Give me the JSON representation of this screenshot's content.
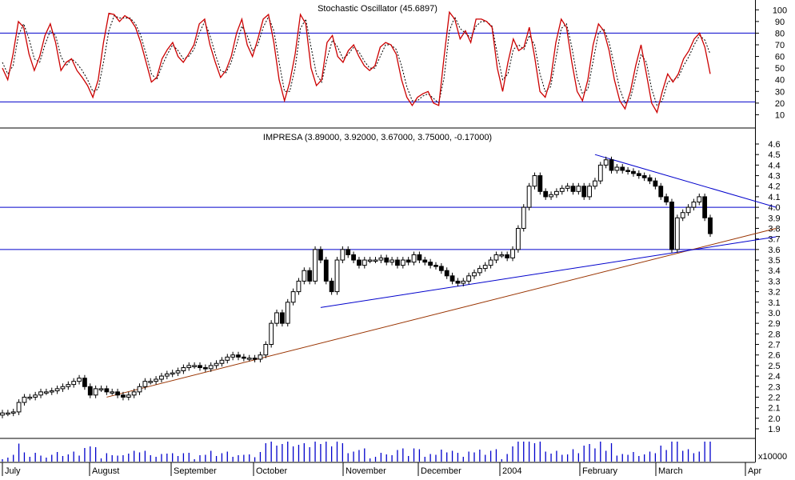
{
  "chart_data": [
    {
      "type": "line",
      "title": "Stochastic Oscillator (45.6897)",
      "yticks": [
        10,
        20,
        30,
        40,
        50,
        60,
        70,
        80,
        90,
        100
      ],
      "ylim": [
        0,
        105
      ],
      "hlines": [
        21,
        80
      ],
      "colors": {
        "k": "#cc0000",
        "d": "#000000",
        "hline": "#0000cc"
      },
      "k": [
        50,
        40,
        62,
        90,
        85,
        62,
        48,
        60,
        78,
        88,
        72,
        48,
        55,
        58,
        48,
        42,
        35,
        25,
        40,
        72,
        97,
        96,
        90,
        95,
        92,
        85,
        72,
        55,
        38,
        42,
        58,
        66,
        72,
        60,
        55,
        62,
        70,
        88,
        92,
        70,
        55,
        42,
        48,
        60,
        80,
        92,
        70,
        60,
        75,
        92,
        96,
        72,
        40,
        22,
        38,
        62,
        96,
        88,
        50,
        35,
        40,
        72,
        78,
        60,
        55,
        65,
        70,
        60,
        52,
        48,
        52,
        68,
        72,
        70,
        62,
        40,
        25,
        18,
        25,
        28,
        30,
        20,
        18,
        60,
        98,
        92,
        75,
        82,
        72,
        92,
        92,
        90,
        85,
        50,
        30,
        55,
        75,
        65,
        68,
        85,
        60,
        30,
        25,
        40,
        72,
        92,
        85,
        55,
        30,
        22,
        40,
        70,
        88,
        82,
        65,
        40,
        22,
        15,
        30,
        52,
        70,
        45,
        20,
        12,
        30,
        45,
        38,
        45,
        58,
        65,
        75,
        80,
        68,
        45
      ],
      "d": [
        55,
        45,
        52,
        78,
        88,
        75,
        58,
        55,
        70,
        82,
        78,
        60,
        52,
        58,
        54,
        48,
        40,
        30,
        32,
        55,
        82,
        95,
        93,
        93,
        93,
        88,
        78,
        62,
        45,
        40,
        52,
        62,
        70,
        65,
        58,
        60,
        66,
        80,
        90,
        78,
        62,
        48,
        46,
        55,
        70,
        86,
        78,
        65,
        70,
        85,
        94,
        82,
        55,
        30,
        30,
        50,
        84,
        92,
        68,
        45,
        38,
        58,
        74,
        68,
        58,
        62,
        68,
        64,
        56,
        50,
        50,
        60,
        70,
        70,
        66,
        52,
        34,
        22,
        22,
        26,
        28,
        24,
        20,
        42,
        82,
        94,
        84,
        80,
        76,
        86,
        90,
        90,
        86,
        62,
        40,
        45,
        66,
        70,
        66,
        78,
        70,
        45,
        30,
        34,
        58,
        84,
        88,
        68,
        42,
        28,
        32,
        56,
        80,
        84,
        72,
        52,
        32,
        20,
        24,
        42,
        62,
        55,
        32,
        18,
        22,
        38,
        40,
        42,
        52,
        60,
        70,
        78,
        74,
        62
      ]
    },
    {
      "type": "candlestick",
      "title": "IMPRESA (3.89000, 3.92000, 3.67000, 3.75000, -0.17000)",
      "yticks": [
        1.9,
        2.0,
        2.1,
        2.2,
        2.3,
        2.4,
        2.5,
        2.6,
        2.7,
        2.8,
        2.9,
        3.0,
        3.1,
        3.2,
        3.3,
        3.4,
        3.5,
        3.6,
        3.7,
        3.8,
        3.9,
        4.0,
        4.1,
        4.2,
        4.3,
        4.4,
        4.5,
        4.6
      ],
      "xlabels": [
        "July",
        "August",
        "September",
        "October",
        "November",
        "December",
        "2004",
        "February",
        "March",
        "Apr"
      ],
      "close": [
        2.05,
        2.05,
        2.06,
        2.15,
        2.2,
        2.2,
        2.22,
        2.25,
        2.25,
        2.26,
        2.28,
        2.3,
        2.32,
        2.35,
        2.38,
        2.3,
        2.22,
        2.28,
        2.28,
        2.25,
        2.25,
        2.22,
        2.2,
        2.22,
        2.25,
        2.3,
        2.35,
        2.35,
        2.37,
        2.4,
        2.42,
        2.43,
        2.45,
        2.48,
        2.5,
        2.5,
        2.48,
        2.47,
        2.5,
        2.52,
        2.55,
        2.58,
        2.6,
        2.58,
        2.57,
        2.57,
        2.56,
        2.6,
        2.7,
        2.9,
        3.0,
        2.9,
        3.1,
        3.2,
        3.3,
        3.4,
        3.3,
        3.6,
        3.5,
        3.3,
        3.2,
        3.5,
        3.6,
        3.55,
        3.5,
        3.45,
        3.5,
        3.5,
        3.5,
        3.52,
        3.48,
        3.5,
        3.45,
        3.5,
        3.48,
        3.55,
        3.5,
        3.48,
        3.45,
        3.44,
        3.4,
        3.35,
        3.3,
        3.28,
        3.3,
        3.35,
        3.38,
        3.42,
        3.45,
        3.5,
        3.55,
        3.55,
        3.52,
        3.6,
        3.8,
        4.0,
        4.2,
        4.3,
        4.15,
        4.1,
        4.12,
        4.15,
        4.18,
        4.2,
        4.15,
        4.2,
        4.1,
        4.2,
        4.25,
        4.4,
        4.45,
        4.35,
        4.38,
        4.35,
        4.34,
        4.32,
        4.3,
        4.28,
        4.25,
        4.2,
        4.1,
        4.05,
        3.6,
        3.9,
        3.95,
        4.0,
        4.05,
        4.1,
        3.9,
        3.75
      ],
      "colors": {
        "candle": "#000000",
        "hline": "#0000cc",
        "resistance": "#0000cc",
        "support": "#0000cc",
        "trend": "#993300"
      },
      "hlines": [
        4.0,
        3.6
      ]
    }
  ]
}
